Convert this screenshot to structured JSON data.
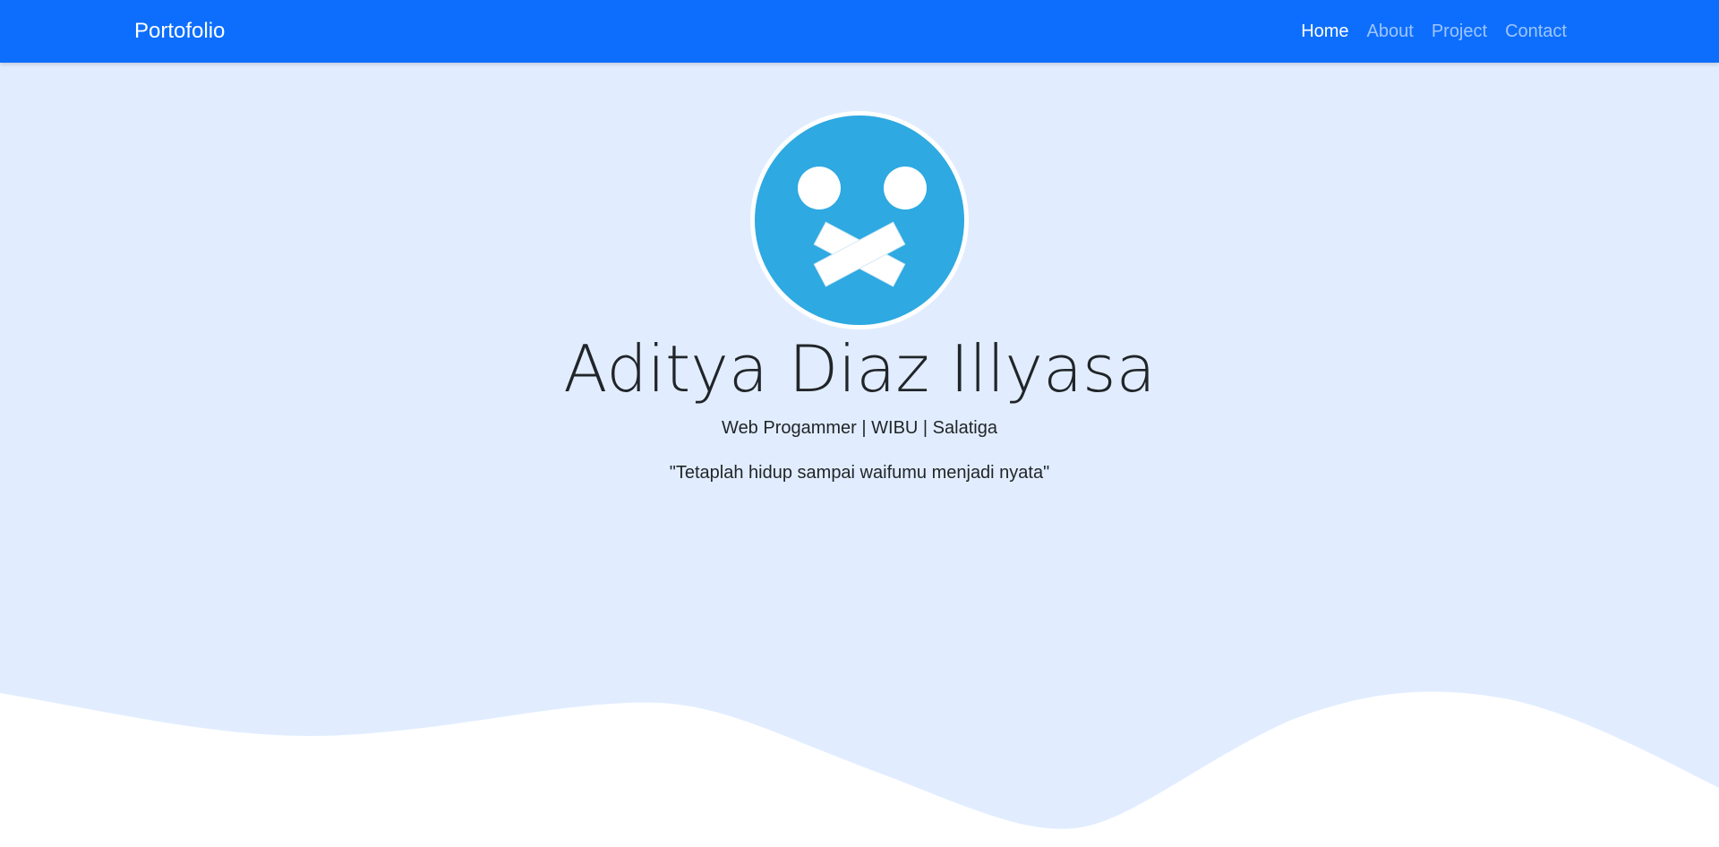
{
  "navbar": {
    "brand": "Portofolio",
    "links": [
      {
        "label": "Home",
        "active": true
      },
      {
        "label": "About",
        "active": false
      },
      {
        "label": "Project",
        "active": false
      },
      {
        "label": "Contact",
        "active": false
      }
    ]
  },
  "hero": {
    "name": "Aditya Diaz Illyasa",
    "subtitle": "Web Progammer | WIBU | Salatiga",
    "quote": "\"Tetaplah hidup sampai waifumu menjadi nyata\""
  },
  "colors": {
    "navbar_bg": "#0d6efd",
    "hero_bg": "#e1edff",
    "avatar_bg": "#2ea9e1",
    "wave_fill": "#ffffff"
  },
  "icons": {
    "avatar": "taped-mouth-face-icon"
  }
}
